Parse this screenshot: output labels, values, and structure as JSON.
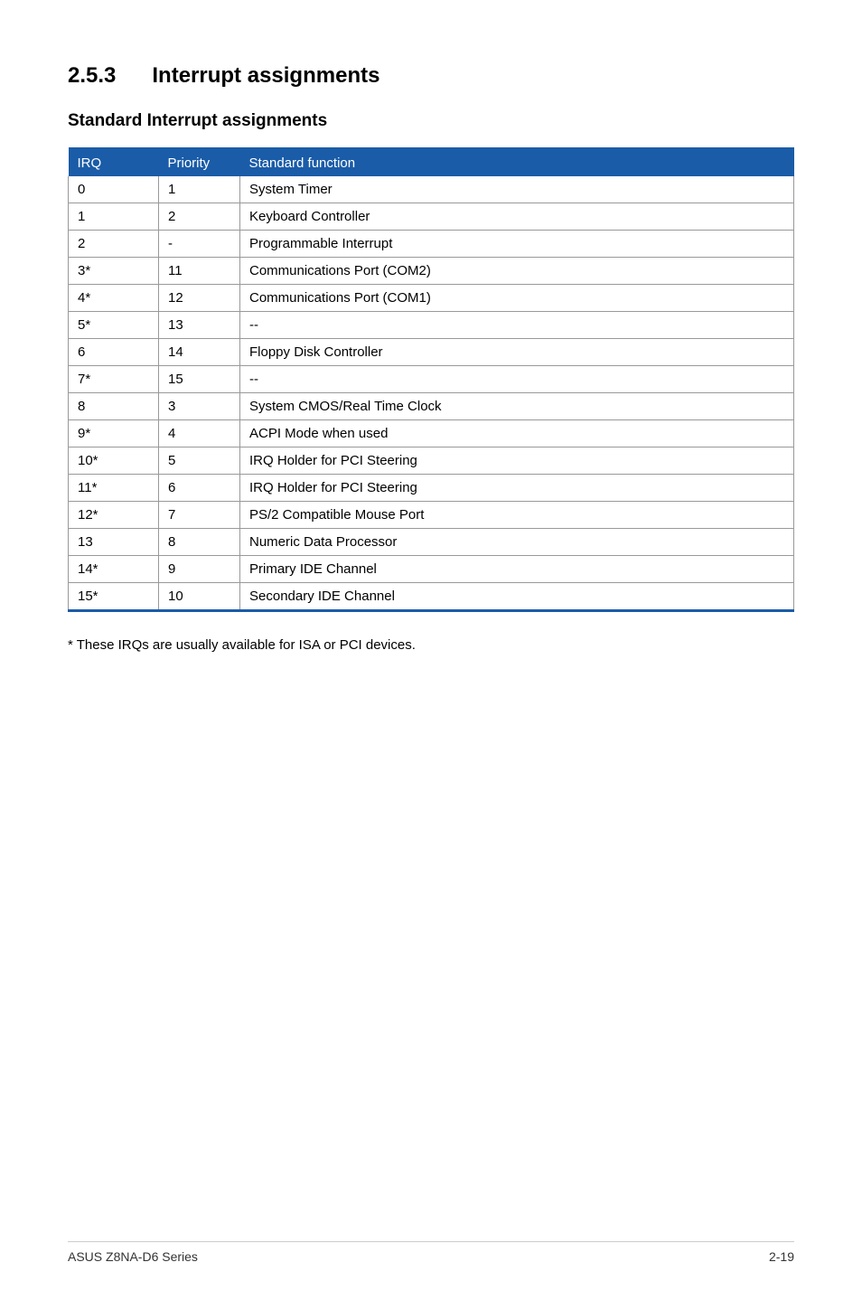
{
  "section": {
    "number": "2.5.3",
    "title": "Interrupt assignments"
  },
  "subheading": "Standard Interrupt assignments",
  "table": {
    "headers": {
      "irq": "IRQ",
      "priority": "Priority",
      "function": "Standard function"
    },
    "rows": [
      {
        "irq": "0",
        "priority": "1",
        "function": "System Timer"
      },
      {
        "irq": "1",
        "priority": "2",
        "function": "Keyboard Controller"
      },
      {
        "irq": "2",
        "priority": "-",
        "function": "Programmable Interrupt"
      },
      {
        "irq": "3*",
        "priority": "11",
        "function": "Communications Port (COM2)"
      },
      {
        "irq": "4*",
        "priority": "12",
        "function": "Communications Port (COM1)"
      },
      {
        "irq": "5*",
        "priority": "13",
        "function": "--"
      },
      {
        "irq": "6",
        "priority": "14",
        "function": "Floppy Disk Controller"
      },
      {
        "irq": "7*",
        "priority": "15",
        "function": "--"
      },
      {
        "irq": "8",
        "priority": "3",
        "function": "System CMOS/Real Time Clock"
      },
      {
        "irq": "9*",
        "priority": "4",
        "function": "ACPI Mode when used"
      },
      {
        "irq": "10*",
        "priority": "5",
        "function": "IRQ Holder for PCI Steering"
      },
      {
        "irq": "11*",
        "priority": "6",
        "function": "IRQ Holder for PCI Steering"
      },
      {
        "irq": "12*",
        "priority": "7",
        "function": "PS/2 Compatible Mouse Port"
      },
      {
        "irq": "13",
        "priority": "8",
        "function": "Numeric Data Processor"
      },
      {
        "irq": "14*",
        "priority": "9",
        "function": "Primary IDE Channel"
      },
      {
        "irq": "15*",
        "priority": "10",
        "function": "Secondary IDE Channel"
      }
    ]
  },
  "note": "* These IRQs are usually available for ISA or PCI devices.",
  "footer": {
    "left": "ASUS Z8NA-D6 Series",
    "right": "2-19"
  }
}
